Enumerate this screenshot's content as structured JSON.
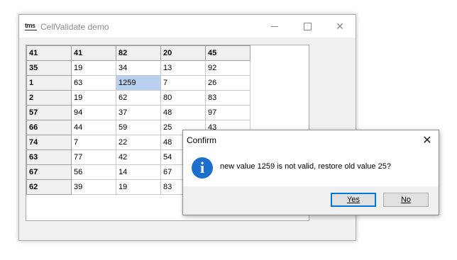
{
  "window": {
    "icon_text": "tms",
    "title": "CellValidate demo",
    "min_glyph": "",
    "close_glyph": "✕"
  },
  "grid": {
    "header_row": [
      "41",
      "41",
      "82",
      "20",
      "45"
    ],
    "rows": [
      [
        "35",
        "19",
        "34",
        "13",
        "92"
      ],
      [
        "1",
        "63",
        "1259",
        "7",
        "26"
      ],
      [
        "2",
        "19",
        "62",
        "80",
        "83"
      ],
      [
        "57",
        "94",
        "37",
        "48",
        "97"
      ],
      [
        "66",
        "44",
        "59",
        "25",
        "43"
      ],
      [
        "74",
        "7",
        "22",
        "48",
        ""
      ],
      [
        "63",
        "77",
        "42",
        "54",
        ""
      ],
      [
        "67",
        "56",
        "14",
        "67",
        ""
      ],
      [
        "62",
        "39",
        "19",
        "83",
        ""
      ]
    ],
    "selected_cell": {
      "row": 1,
      "col": 2
    }
  },
  "dialog": {
    "title": "Confirm",
    "close_glyph": "✕",
    "icon_glyph": "i",
    "message": "new value 1259 is not valid, restore old value 25?",
    "yes_label": "Yes",
    "no_label": "No"
  }
}
